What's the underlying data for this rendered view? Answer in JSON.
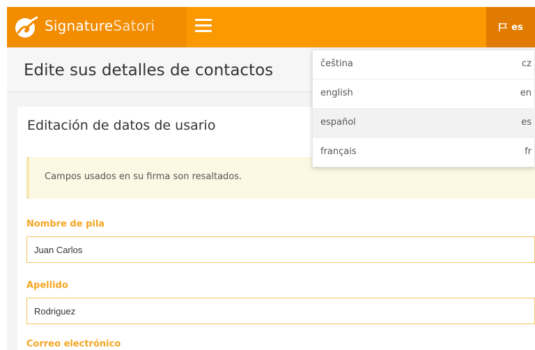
{
  "brand": {
    "name_main": "Signature",
    "name_light": "Satori"
  },
  "language_toggle": {
    "label": "es",
    "icon": "flag-icon"
  },
  "page": {
    "title": "Edite sus detalles de contactos"
  },
  "card": {
    "title": "Editación de datos de usario",
    "alert": "Campos usados en su firma son resaltados."
  },
  "form": {
    "fields": [
      {
        "label": "Nombre de pila",
        "value": "Juan Carlos"
      },
      {
        "label": "Apellido",
        "value": "Rodriguez"
      },
      {
        "label": "Correo electrónico",
        "value": ""
      }
    ]
  },
  "languages": [
    {
      "name": "čeština",
      "code": "cz"
    },
    {
      "name": "english",
      "code": "en"
    },
    {
      "name": "español",
      "code": "es"
    },
    {
      "name": "français",
      "code": "fr"
    }
  ],
  "colors": {
    "accent": "#fb9902",
    "label": "#f5a623",
    "alert_bg": "#fcf8e3"
  }
}
